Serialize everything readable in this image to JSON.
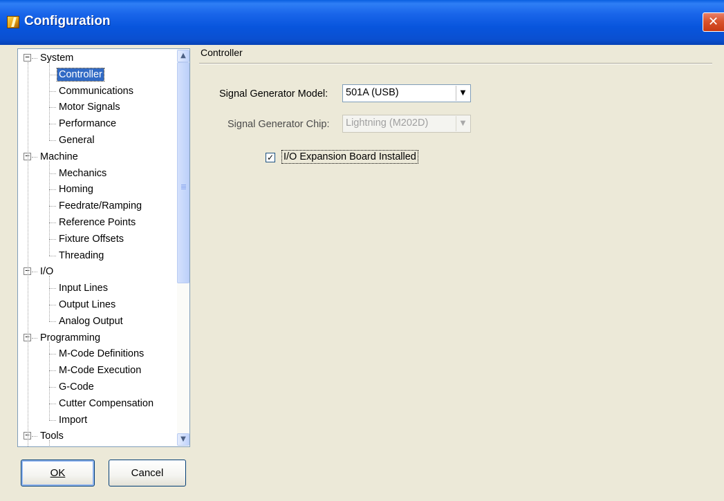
{
  "window": {
    "title": "Configuration",
    "close_glyph": "✕",
    "icon": "app-icon",
    "title_bar_color": "#0a55dd"
  },
  "tree": {
    "selected_color": "#316ac5",
    "items": [
      {
        "label": "System",
        "expander": "−",
        "level": 0
      },
      {
        "label": "Controller",
        "level": 1,
        "selected": true
      },
      {
        "label": "Communications",
        "level": 1
      },
      {
        "label": "Motor Signals",
        "level": 1
      },
      {
        "label": "Performance",
        "level": 1
      },
      {
        "label": "General",
        "level": 1
      },
      {
        "label": "Machine",
        "expander": "−",
        "level": 0
      },
      {
        "label": "Mechanics",
        "level": 1
      },
      {
        "label": "Homing",
        "level": 1
      },
      {
        "label": "Feedrate/Ramping",
        "level": 1
      },
      {
        "label": "Reference Points",
        "level": 1
      },
      {
        "label": "Fixture Offsets",
        "level": 1
      },
      {
        "label": "Threading",
        "level": 1
      },
      {
        "label": "I/O",
        "expander": "−",
        "level": 0
      },
      {
        "label": "Input Lines",
        "level": 1
      },
      {
        "label": "Output Lines",
        "level": 1
      },
      {
        "label": "Analog Output",
        "level": 1
      },
      {
        "label": "Programming",
        "expander": "−",
        "level": 0
      },
      {
        "label": "M-Code Definitions",
        "level": 1
      },
      {
        "label": "M-Code Execution",
        "level": 1
      },
      {
        "label": "G-Code",
        "level": 1
      },
      {
        "label": "Cutter Compensation",
        "level": 1
      },
      {
        "label": "Import",
        "level": 1
      },
      {
        "label": "Tools",
        "expander": "−",
        "level": 0
      }
    ],
    "scroll_up_glyph": "▲",
    "scroll_down_glyph": "▼"
  },
  "buttons": {
    "ok_label": "OK",
    "cancel_label": "Cancel"
  },
  "panel": {
    "title": "Controller",
    "signal_generator_model": {
      "label": "Signal Generator Model:",
      "value": "501A (USB)",
      "arrow": "▼"
    },
    "signal_generator_chip": {
      "label": "Signal Generator Chip:",
      "value": "Lightning (M202D)",
      "arrow": "▼",
      "disabled": true
    },
    "io_expansion": {
      "label": "I/O Expansion Board Installed",
      "checked": true,
      "check_glyph": "✓"
    }
  }
}
